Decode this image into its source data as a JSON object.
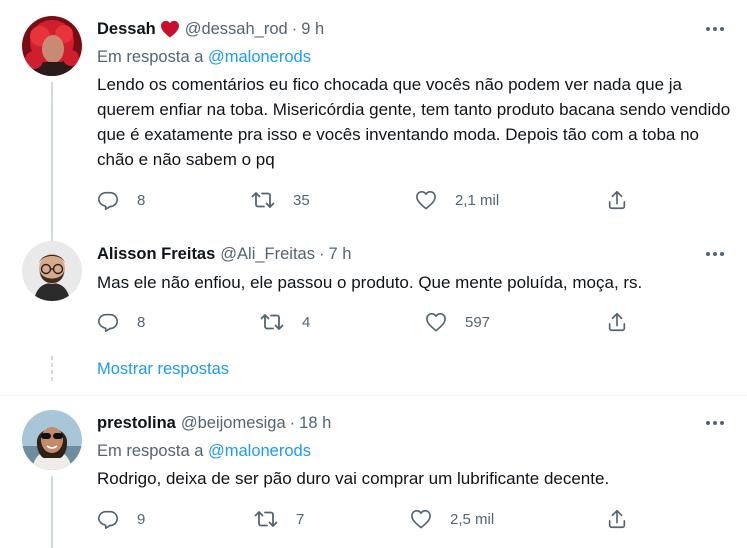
{
  "tweets": [
    {
      "name": "Dessah",
      "has_heart": true,
      "handle": "@dessah_rod",
      "dot": "·",
      "time": "9 h",
      "reply_prefix": "Em resposta a",
      "reply_to": "@malonerods",
      "text": "Lendo os comentários eu fico chocada que vocês não podem ver nada que ja querem enfiar na toba. Misericórdia gente, tem tanto produto bacana sendo vendido que é exatamente pra isso e vocês inventando moda. Depois tão com a toba no chão e não sabem o pq",
      "replies": "8",
      "retweets": "35",
      "likes": "2,1 mil"
    },
    {
      "name": "Alisson Freitas",
      "handle": "@Ali_Freitas",
      "dot": "·",
      "time": "7 h",
      "text": "Mas ele não enfiou, ele passou o produto. Que mente poluída, moça, rs.",
      "replies": "8",
      "retweets": "4",
      "likes": "597"
    },
    {
      "name": "prestolina",
      "handle": "@beijomesiga",
      "dot": "·",
      "time": "18 h",
      "reply_prefix": "Em resposta a",
      "reply_to": "@malonerods",
      "text": "Rodrigo, deixa de ser pão duro vai comprar um lubrificante decente.",
      "replies": "9",
      "retweets": "7",
      "likes": "2,5 mil"
    }
  ],
  "show_replies_label": "Mostrar respostas",
  "colors": {
    "accent": "#1d9bf0",
    "secondary_text": "#536471",
    "heart": "#e0245e",
    "divider": "#eff3f4"
  },
  "icons": [
    "reply-icon",
    "retweet-icon",
    "like-icon",
    "share-icon",
    "more-icon",
    "heart-icon"
  ]
}
